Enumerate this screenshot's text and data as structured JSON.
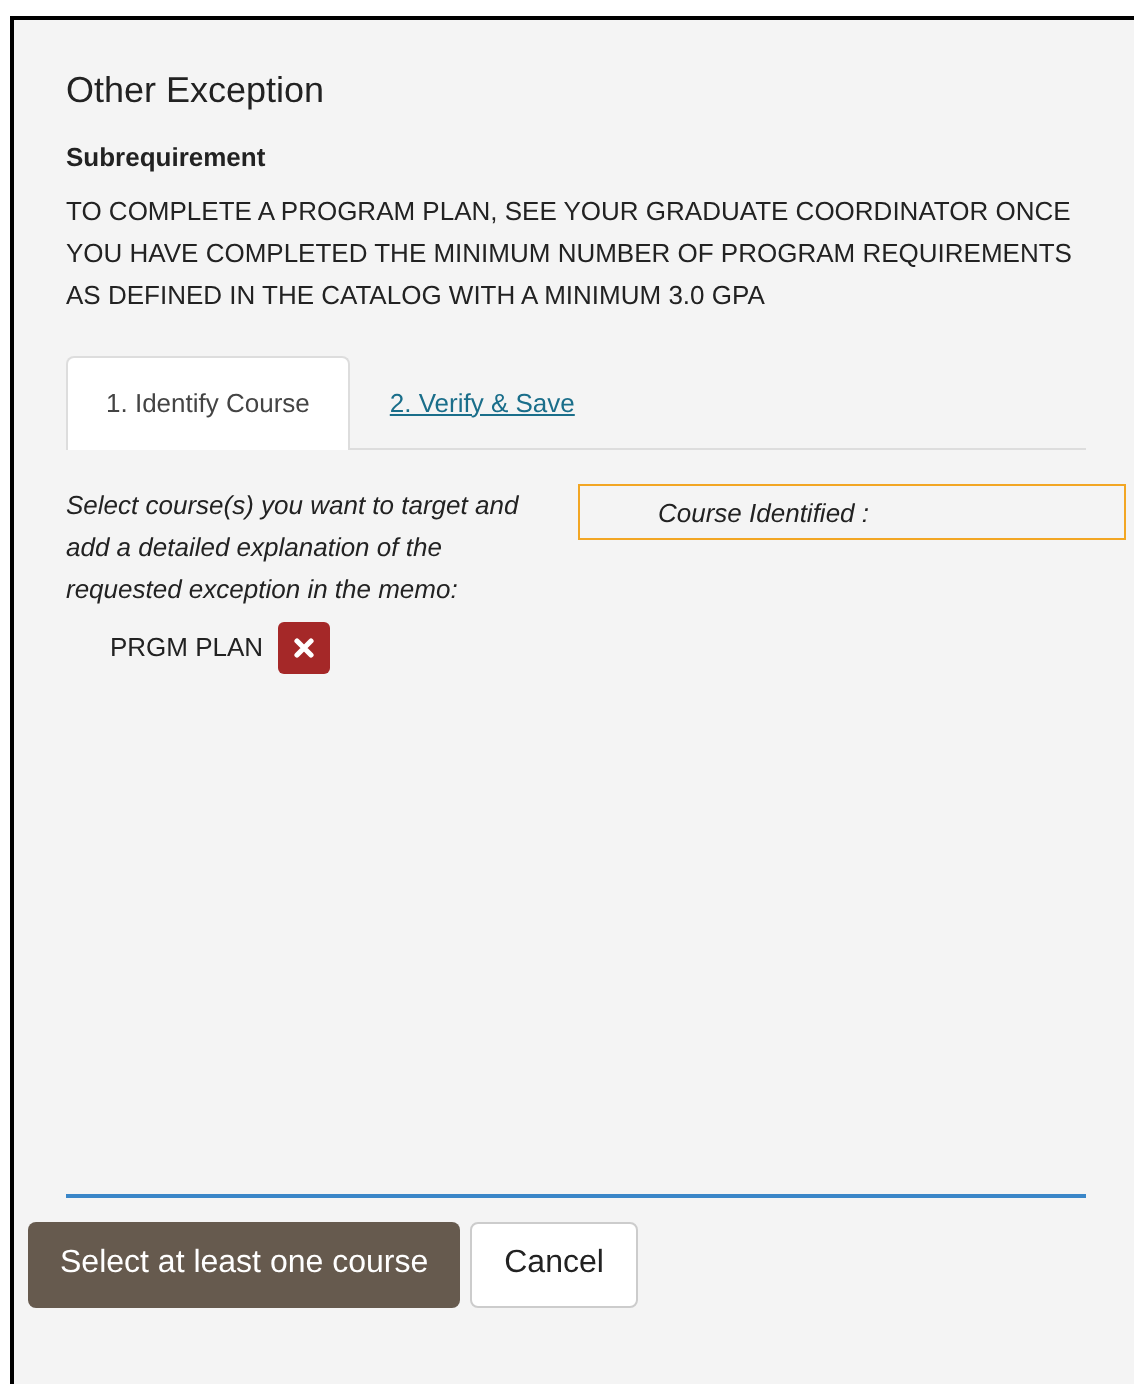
{
  "dialog": {
    "title": "Other Exception",
    "subheading": "Subrequirement",
    "description": "TO COMPLETE A PROGRAM PLAN, SEE YOUR GRADUATE COORDINATOR ONCE YOU HAVE COMPLETED THE MINIMUM NUMBER OF PROGRAM REQUIREMENTS AS DEFINED IN THE CATALOG WITH A MINIMUM 3.0 GPA"
  },
  "tabs": [
    {
      "label": "1. Identify Course",
      "selected": true
    },
    {
      "label": "2. Verify & Save",
      "selected": false
    }
  ],
  "instructions": "Select course(s) you want to target and add a detailed explanation of the requested exception in the memo:",
  "courses": [
    {
      "name": "PRGM PLAN"
    }
  ],
  "identified_label": "Course Identified :",
  "buttons": [
    {
      "label": "Select at least one course",
      "kind": "primary"
    },
    {
      "label": "Cancel",
      "kind": "secondary"
    }
  ]
}
